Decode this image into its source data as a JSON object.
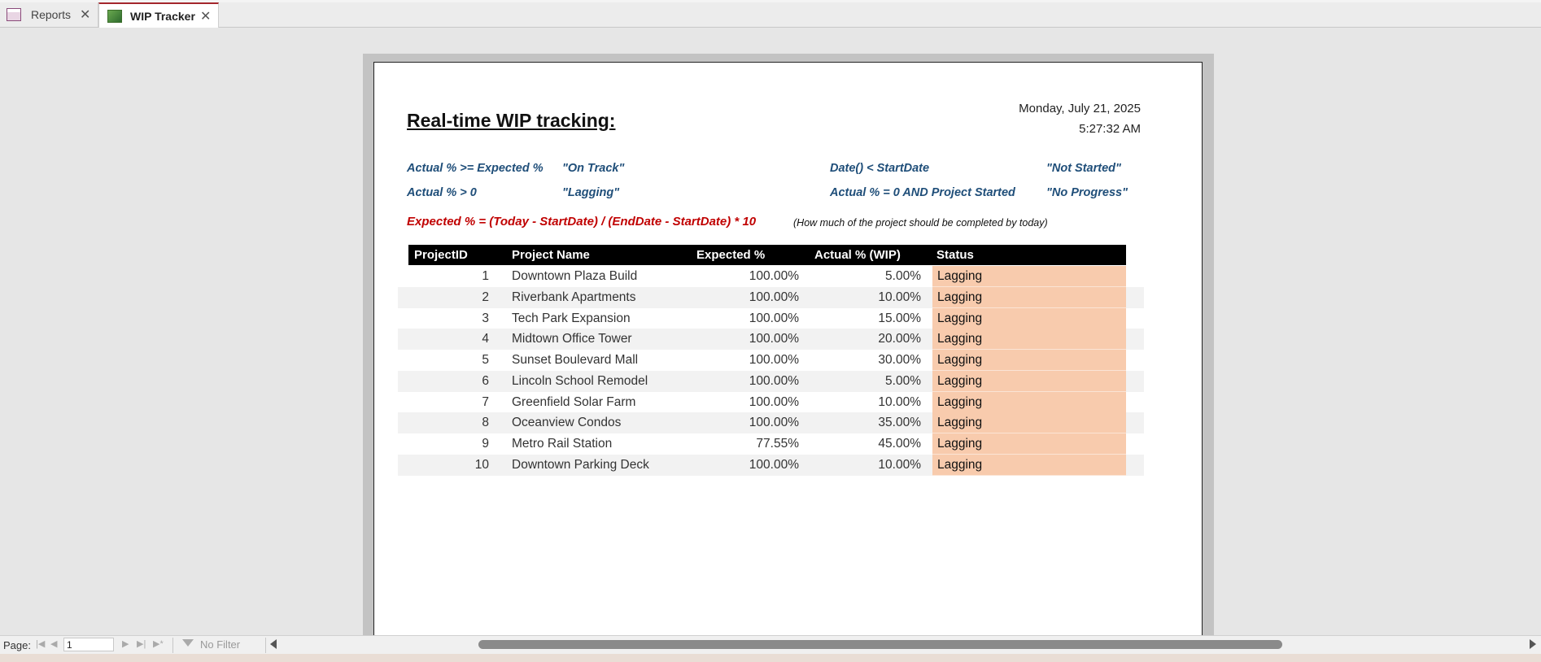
{
  "tabs": [
    {
      "label": "Reports",
      "icon": "report-list-icon"
    },
    {
      "label": "WIP Tracker",
      "icon": "report-icon",
      "active": true
    }
  ],
  "report": {
    "title": "Real-time WIP tracking:",
    "date": "Monday, July 21, 2025",
    "time": "5:27:32 AM",
    "rules": [
      {
        "condition": "Actual % >= Expected %",
        "result": "\"On Track\""
      },
      {
        "condition": "Actual %  > 0",
        "result": "\"Lagging\""
      },
      {
        "condition": "Date() < StartDate",
        "result": "\"Not Started\""
      },
      {
        "condition": "Actual % = 0 AND Project Started",
        "result": "\"No Progress\""
      }
    ],
    "formula": "Expected % = (Today - StartDate) / (EndDate - StartDate) * 10",
    "formula_note": "(How much of the project should be completed by today)",
    "columns": [
      "ProjectID",
      "Project Name",
      "Expected %",
      "Actual % (WIP)",
      "Status"
    ],
    "rows": [
      {
        "id": "1",
        "name": "Downtown Plaza Build",
        "expected": "100.00%",
        "actual": "5.00%",
        "status": "Lagging"
      },
      {
        "id": "2",
        "name": "Riverbank Apartments",
        "expected": "100.00%",
        "actual": "10.00%",
        "status": "Lagging"
      },
      {
        "id": "3",
        "name": "Tech Park Expansion",
        "expected": "100.00%",
        "actual": "15.00%",
        "status": "Lagging"
      },
      {
        "id": "4",
        "name": "Midtown Office Tower",
        "expected": "100.00%",
        "actual": "20.00%",
        "status": "Lagging"
      },
      {
        "id": "5",
        "name": "Sunset Boulevard Mall",
        "expected": "100.00%",
        "actual": "30.00%",
        "status": "Lagging"
      },
      {
        "id": "6",
        "name": "Lincoln School Remodel",
        "expected": "100.00%",
        "actual": "5.00%",
        "status": "Lagging"
      },
      {
        "id": "7",
        "name": "Greenfield Solar Farm",
        "expected": "100.00%",
        "actual": "10.00%",
        "status": "Lagging"
      },
      {
        "id": "8",
        "name": "Oceanview Condos",
        "expected": "100.00%",
        "actual": "35.00%",
        "status": "Lagging"
      },
      {
        "id": "9",
        "name": "Metro Rail Station",
        "expected": "77.55%",
        "actual": "45.00%",
        "status": "Lagging"
      },
      {
        "id": "10",
        "name": "Downtown Parking Deck",
        "expected": "100.00%",
        "actual": "10.00%",
        "status": "Lagging"
      }
    ]
  },
  "statusbar": {
    "page_label": "Page:",
    "page_value": "1",
    "filter_label": "No Filter"
  },
  "colors": {
    "status_lagging": "#f8cbad",
    "rule_text": "#1f4e79",
    "formula_text": "#c00000",
    "active_tab_accent": "#a4262c"
  }
}
